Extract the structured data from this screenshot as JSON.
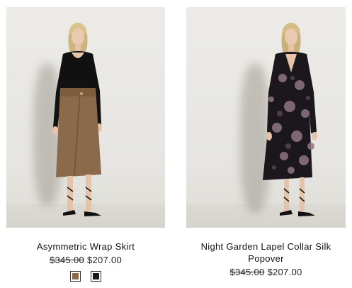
{
  "products": [
    {
      "name": "Asymmetric Wrap Skirt",
      "price_original": "$345.00",
      "price_sale": "$207.00",
      "swatches": [
        {
          "name": "brown-swatch",
          "color": "#8a6a4a"
        },
        {
          "name": "black-swatch",
          "color": "#1a1a1a"
        }
      ]
    },
    {
      "name": "Night Garden Lapel Collar Silk Popover",
      "price_original": "$345.00",
      "price_sale": "$207.00"
    }
  ]
}
